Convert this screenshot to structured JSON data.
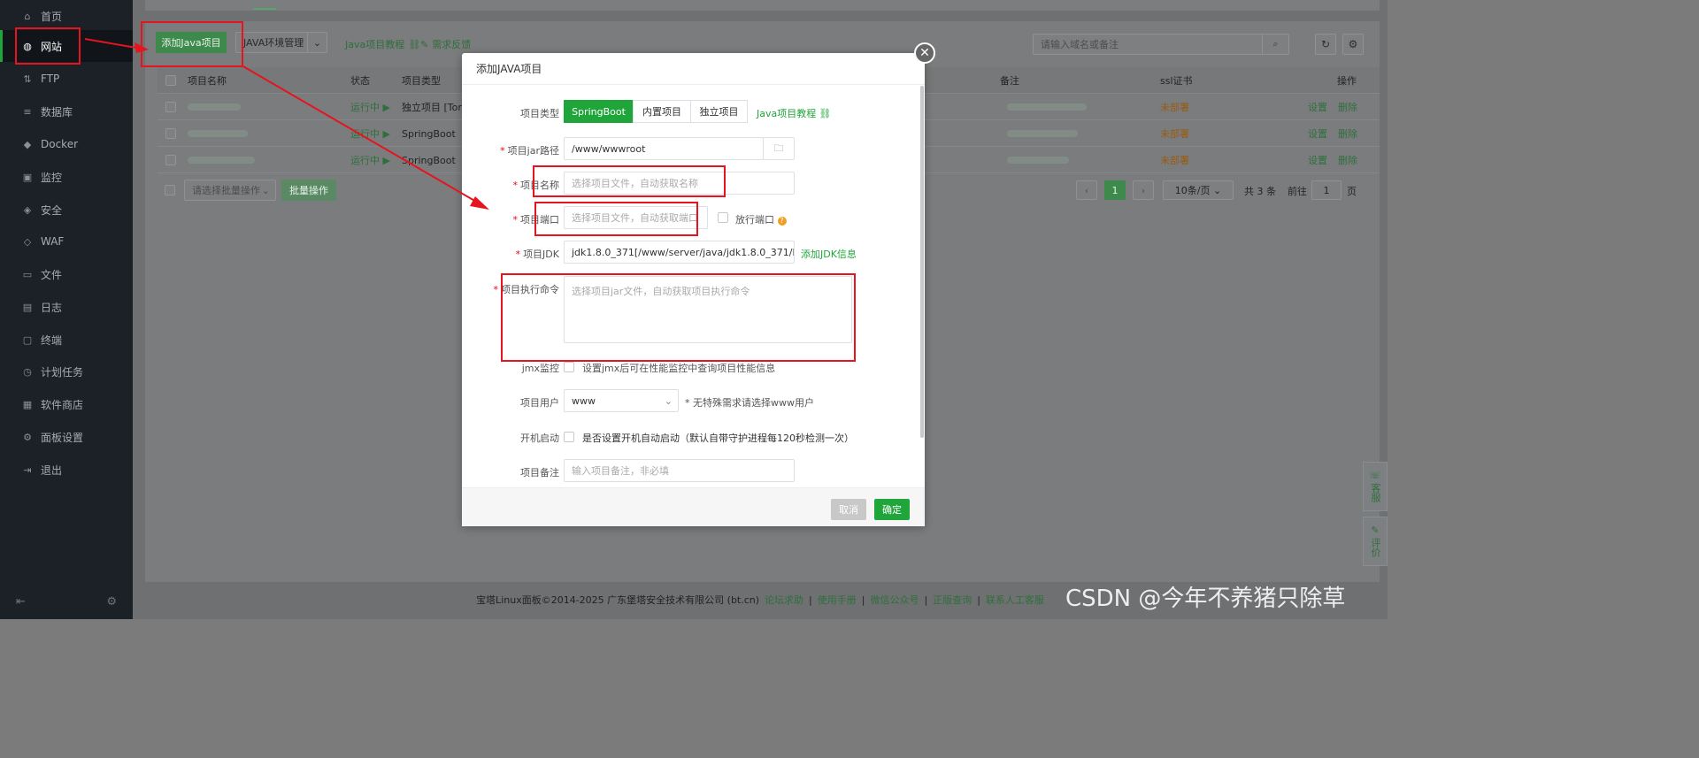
{
  "sidebar": {
    "items": [
      {
        "label": "首页",
        "icon": "home-icon",
        "glyph": "⌂"
      },
      {
        "label": "网站",
        "icon": "globe-icon",
        "glyph": "◍"
      },
      {
        "label": "FTP",
        "icon": "ftp-icon",
        "glyph": "⇅"
      },
      {
        "label": "数据库",
        "icon": "database-icon",
        "glyph": "≡"
      },
      {
        "label": "Docker",
        "icon": "docker-icon",
        "glyph": "◆"
      },
      {
        "label": "监控",
        "icon": "monitor-icon",
        "glyph": "▣"
      },
      {
        "label": "安全",
        "icon": "shield-icon",
        "glyph": "◈"
      },
      {
        "label": "WAF",
        "icon": "waf-icon",
        "glyph": "◇"
      },
      {
        "label": "文件",
        "icon": "folder-icon",
        "glyph": "▭"
      },
      {
        "label": "日志",
        "icon": "log-icon",
        "glyph": "▤"
      },
      {
        "label": "终端",
        "icon": "terminal-icon",
        "glyph": "▢"
      },
      {
        "label": "计划任务",
        "icon": "clock-icon",
        "glyph": "◷"
      },
      {
        "label": "软件商店",
        "icon": "grid-icon",
        "glyph": "▦"
      },
      {
        "label": "面板设置",
        "icon": "gear-icon",
        "glyph": "⚙"
      },
      {
        "label": "退出",
        "icon": "logout-icon",
        "glyph": "⇥"
      }
    ],
    "active_index": 1
  },
  "toolbar": {
    "add_java": "添加Java项目",
    "java_env": "JAVA环境管理",
    "java_tutorial": "Java项目教程",
    "feedback": "需求反馈",
    "search_placeholder": "请输入域名或备注"
  },
  "table": {
    "headers": {
      "name": "项目名称",
      "status": "状态",
      "type": "项目类型",
      "remark": "备注",
      "ssl": "ssl证书",
      "ops": "操作"
    },
    "rows": [
      {
        "status": "运行中 ▶",
        "type": "独立项目 [Tomc",
        "ssl": "未部署",
        "set": "设置",
        "del": "删除"
      },
      {
        "status": "运行中 ▶",
        "type": "SpringBoot",
        "ssl": "未部署",
        "set": "设置",
        "del": "删除"
      },
      {
        "status": "运行中 ▶",
        "type": "SpringBoot",
        "ssl": "未部署",
        "set": "设置",
        "del": "删除"
      }
    ]
  },
  "batch": {
    "select_placeholder": "请选择批量操作",
    "button": "批量操作"
  },
  "pager": {
    "page": "1",
    "per_page": "10条/页",
    "total": "共 3 条",
    "goto": "前往",
    "goto_value": "1",
    "unit": "页"
  },
  "footer": {
    "copyright": "宝塔Linux面板©2014-2025 广东堡塔安全技术有限公司 (bt.cn)",
    "links": [
      "论坛求助",
      "使用手册",
      "微信公众号",
      "正版查询",
      "联系人工客服"
    ]
  },
  "float": {
    "service": "客服",
    "review": "评价"
  },
  "modal": {
    "title": "添加JAVA项目",
    "type_label": "项目类型",
    "type_options": [
      "SpringBoot",
      "内置项目",
      "独立项目"
    ],
    "type_selected": 0,
    "tutorial": "Java项目教程",
    "jar_label": "项目jar路径",
    "jar_value": "/www/wwwroot",
    "name_label": "项目名称",
    "name_placeholder": "选择项目文件，自动获取名称",
    "port_label": "项目端口",
    "port_placeholder": "选择项目文件，自动获取端口",
    "open_port": "放行端口",
    "jdk_label": "项目JDK",
    "jdk_value": "jdk1.8.0_371[/www/server/java/jdk1.8.0_371/bin/java]",
    "add_jdk": "添加JDK信息",
    "cmd_label": "项目执行命令",
    "cmd_placeholder": "选择项目jar文件，自动获取项目执行命令",
    "jmx_label": "jmx监控",
    "jmx_text": "设置jmx后可在性能监控中查询项目性能信息",
    "user_label": "项目用户",
    "user_value": "www",
    "user_hint": "* 无特殊需求请选择www用户",
    "boot_label": "开机启动",
    "boot_text": "是否设置开机自动启动（默认自带守护进程每120秒检测一次）",
    "remark_label": "项目备注",
    "remark_placeholder": "输入项目备注，非必填",
    "cancel": "取消",
    "confirm": "确定"
  },
  "watermark": "CSDN @今年不养猪只除草",
  "colors": {
    "accent": "#20a53a",
    "annotation": "#e5141e",
    "warn": "#c47a1f"
  }
}
